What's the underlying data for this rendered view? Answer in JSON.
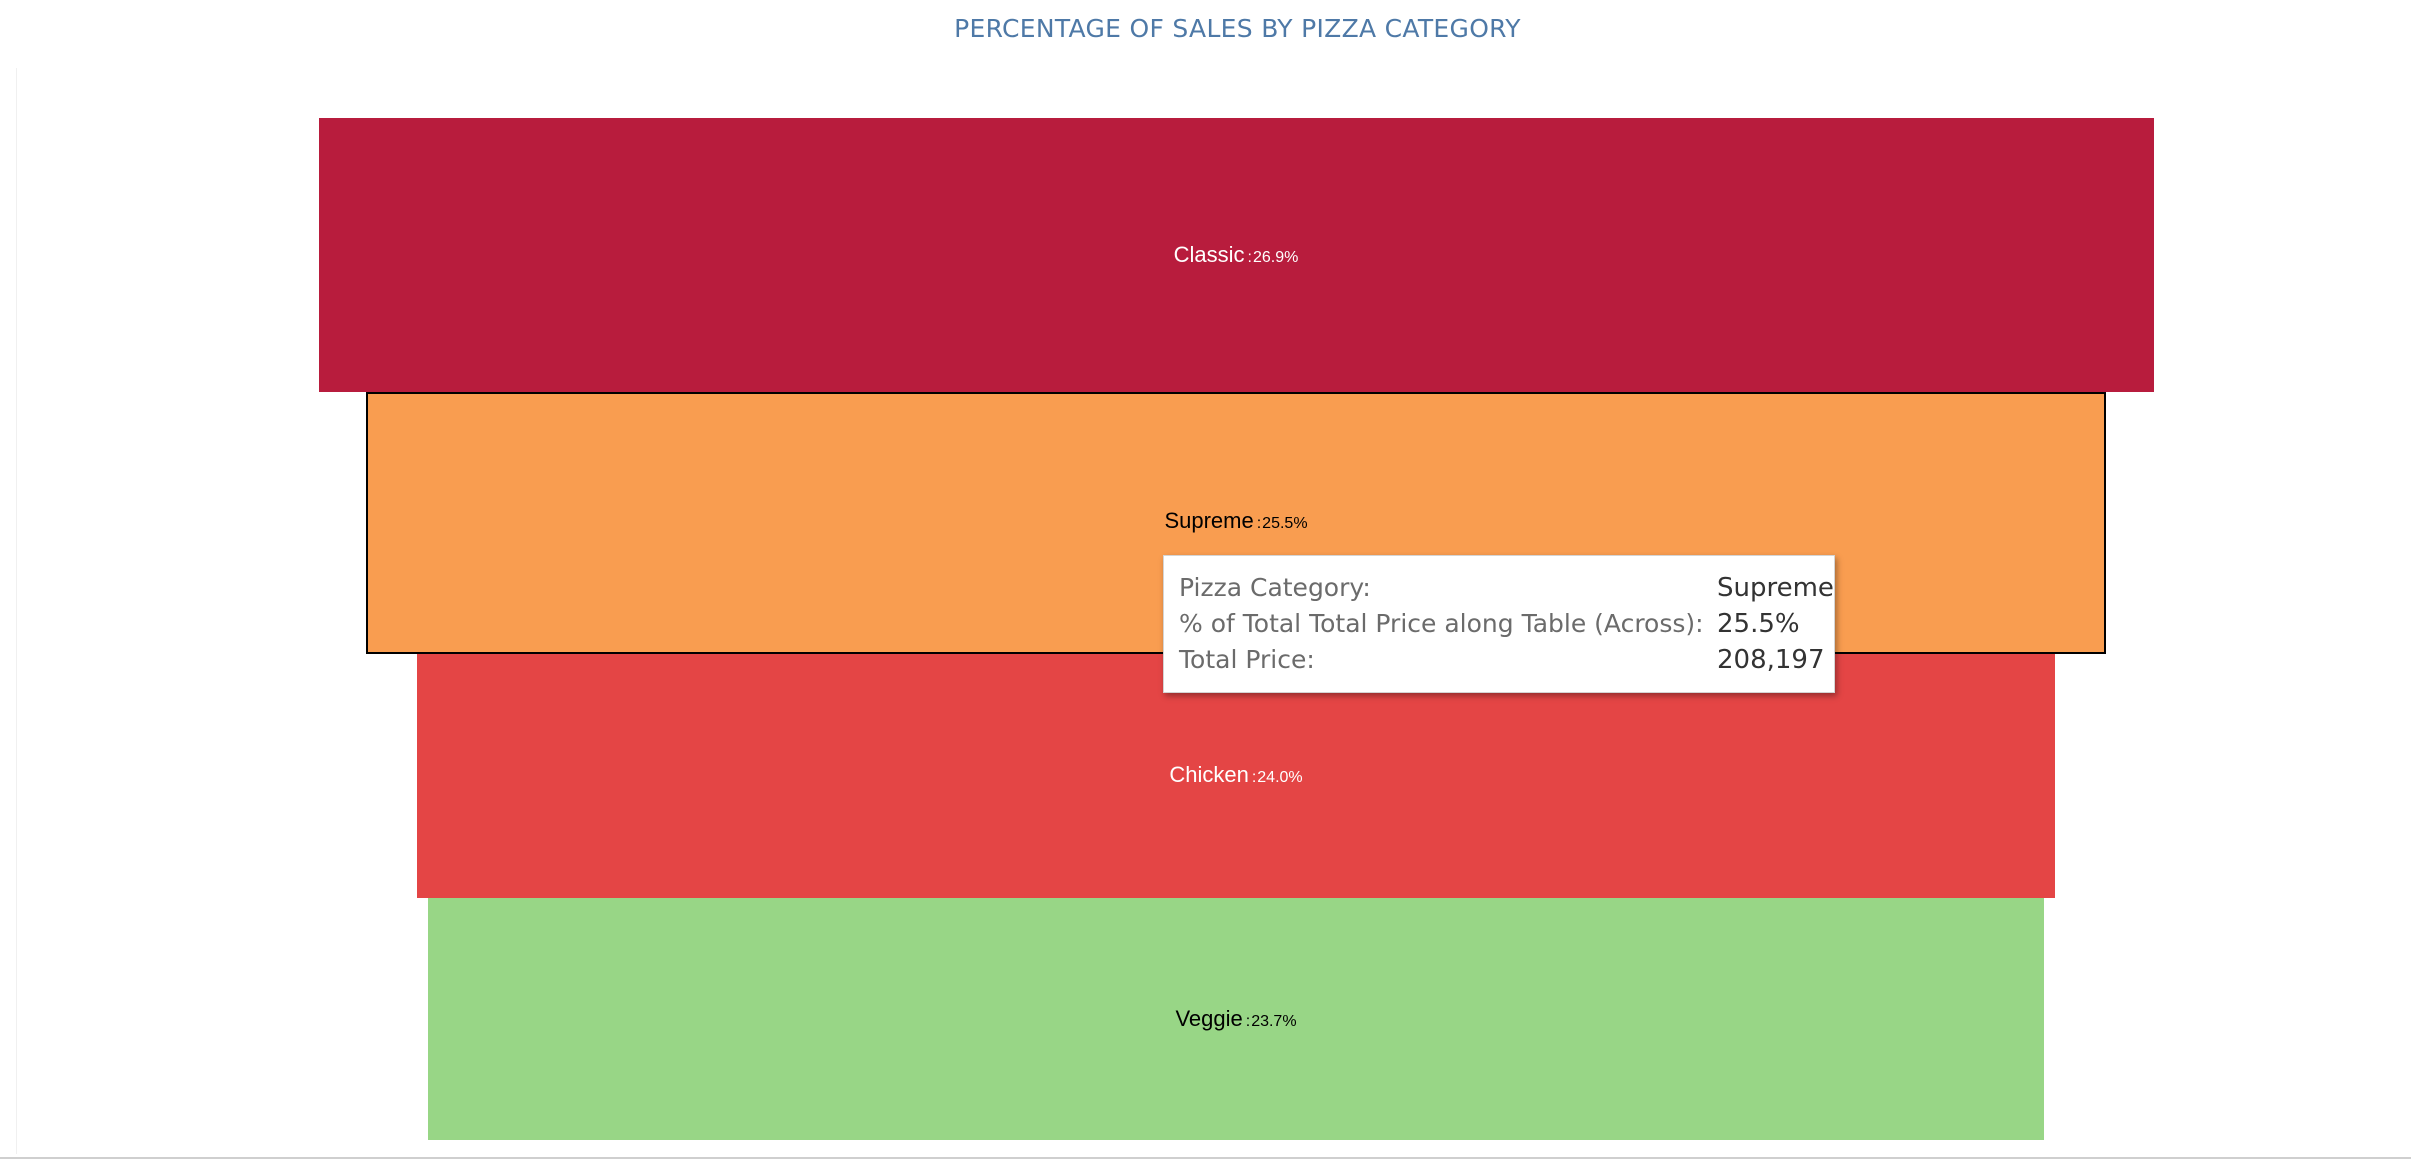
{
  "chart_data": {
    "type": "bar",
    "title": "PERCENTAGE OF SALES BY PIZZA CATEGORY",
    "categories": [
      "Classic",
      "Supreme",
      "Chicken",
      "Veggie"
    ],
    "values": [
      26.9,
      25.5,
      24.0,
      23.7
    ],
    "value_labels": [
      "26.9%",
      "25.5%",
      "24.0%",
      "23.7%"
    ],
    "colors": [
      "#b81c3d",
      "#f99d50",
      "#e44545",
      "#98d686"
    ],
    "label_colors": [
      "#ffffff",
      "#000000",
      "#ffffff",
      "#000000"
    ],
    "selected_category": "Supreme",
    "xlabel": "",
    "ylabel": ""
  },
  "tooltip": {
    "rows": [
      {
        "key": "Pizza Category:",
        "value": "Supreme"
      },
      {
        "key": "% of Total Total Price along Table (Across):",
        "value": "25.5%"
      },
      {
        "key": "Total Price:",
        "value": "208,197"
      }
    ]
  }
}
